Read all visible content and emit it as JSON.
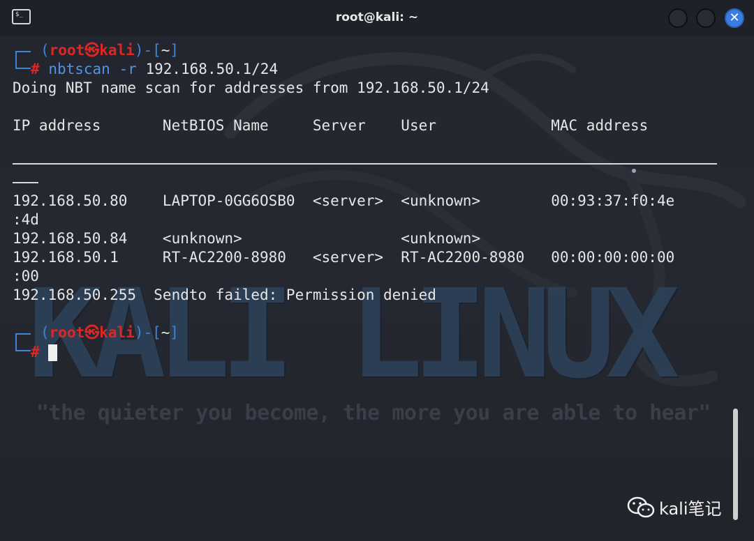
{
  "window": {
    "title": "root@kali: ~",
    "terminal_icon_glyph": "$_",
    "close_glyph": "✕",
    "accent_color": "#3a7ce0"
  },
  "background": {
    "logo_text": "KALI LINUX",
    "quote": "\"the quieter you become, the more you are able to hear\""
  },
  "prompt": {
    "open": "(",
    "user": "root",
    "at": "㉿",
    "host": "kali",
    "close": ")-[",
    "dir": "~",
    "dir_close": "]",
    "hash": "#"
  },
  "command": {
    "name": "nbtscan",
    "flag": "-r",
    "arg": "192.168.50.1/24"
  },
  "output": {
    "scan_line": "Doing NBT name scan for addresses from 192.168.50.1/24",
    "header": "IP address       NetBIOS Name     Server    User             MAC address",
    "rows": [
      "192.168.50.80    LAPTOP-0GG6OSB0  <server>  <unknown>        00:93:37:f0:4e",
      ":4d",
      "192.168.50.84    <unknown>                  <unknown>",
      "192.168.50.1     RT-AC2200-8980   <server>  RT-AC2200-8980   00:00:00:00:00",
      ":00",
      "192.168.50.255  Sendto failed: Permission denied"
    ]
  },
  "watermark": {
    "text": "kali笔记"
  }
}
